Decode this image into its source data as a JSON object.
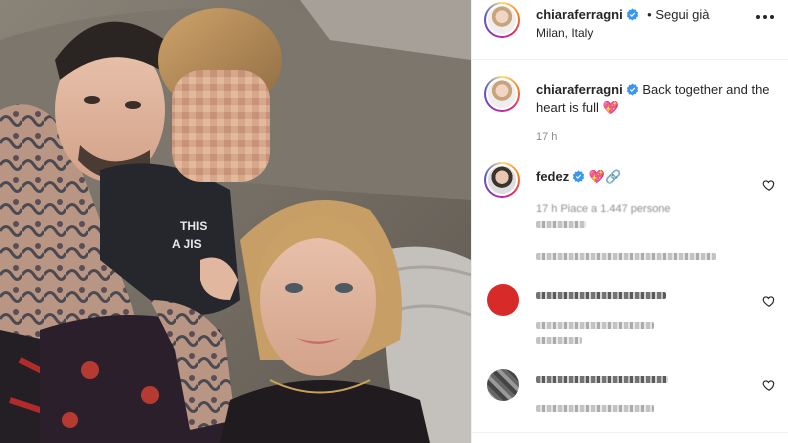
{
  "post": {
    "author": "chiaraferragni",
    "follow_text": "• Segui già",
    "location": "Milan, Italy"
  },
  "caption": {
    "username": "chiaraferragni",
    "text": "Back together and the heart is full 💖",
    "time": "17 h"
  },
  "comments": [
    {
      "username": "fedez",
      "text": "💖🔗",
      "meta": "17 h  Piace a 1.447 persone"
    }
  ],
  "icons": {
    "verified": "verified-badge-icon",
    "more": "more-options-icon",
    "like": "heart-outline-icon"
  },
  "colors": {
    "verified": "#3897f0",
    "accent_ring": "#d62976"
  }
}
